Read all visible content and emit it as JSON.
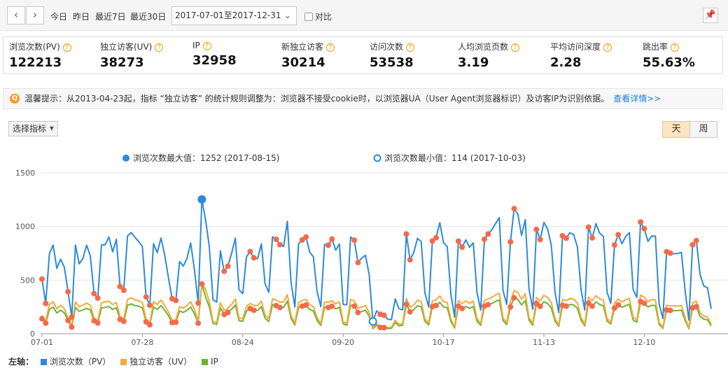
{
  "toolbar": {
    "prev_icon": "chevron-left-icon",
    "next_icon": "chevron-right-icon",
    "quick_ranges": [
      "今日",
      "昨日",
      "最近7日",
      "最近30日"
    ],
    "date_range": "2017-07-01至2017-12-31",
    "compare_label": "对比",
    "pin_icon": "pin-icon"
  },
  "metrics": [
    {
      "label": "浏览次数(PV)",
      "value": "122213"
    },
    {
      "label": "独立访客(UV)",
      "value": "38273"
    },
    {
      "label": "IP",
      "value": "32958"
    },
    {
      "label": "新独立访客",
      "value": "30214"
    },
    {
      "label": "访问次数",
      "value": "53538"
    },
    {
      "label": "人均浏览页数",
      "value": "3.19"
    },
    {
      "label": "平均访问深度",
      "value": "2.28"
    },
    {
      "label": "跳出率",
      "value": "55.63%"
    }
  ],
  "tip": {
    "text": "温馨提示：从2013-04-23起，指标 “独立访客” 的统计规则调整为：浏览器不接受cookie时，以浏览器UA（User Agent浏览器标识）及访客IP为识别依据。",
    "link": "查看详情>>"
  },
  "controls": {
    "metric_selector": "选择指标",
    "day_label": "天",
    "week_label": "周"
  },
  "annotations": {
    "max_label": "浏览次数最大值：1252 (2017-08-15)",
    "min_label": "浏览次数最小值：114 (2017-10-03)"
  },
  "legend": {
    "axis_label": "左轴：",
    "items": [
      {
        "name": "浏览次数（PV）",
        "color": "#2e8ad8"
      },
      {
        "name": "独立访客（UV）",
        "color": "#f5a93a"
      },
      {
        "name": "IP",
        "color": "#6ab52e"
      }
    ]
  },
  "chart_data": {
    "type": "line",
    "ylim": [
      0,
      1500
    ],
    "yticks": [
      "0",
      "500",
      "1000",
      "1500"
    ],
    "xticks": [
      "07-01",
      "07-28",
      "08-24",
      "09-20",
      "10-17",
      "11-13",
      "12-10"
    ],
    "colors": {
      "pv": "#2e8ad8",
      "uv": "#f5a93a",
      "ip": "#6ab52e",
      "weekend_marker": "#f56a4a"
    },
    "series": [
      {
        "name": "浏览次数（PV）",
        "values": [
          509,
          282,
          747,
          826,
          609,
          695,
          620,
          392,
          155,
          826,
          651,
          701,
          826,
          726,
          374,
          332,
          826,
          830,
          902,
          763,
          880,
          440,
          405,
          912,
          943,
          898,
          860,
          812,
          343,
          266,
          839,
          756,
          892,
          733,
          523,
          327,
          310,
          673,
          630,
          702,
          845,
          596,
          286,
          1252,
          1060,
          814,
          317,
          295,
          773,
          582,
          630,
          751,
          891,
          409,
          374,
          719,
          766,
          708,
          700,
          838,
          464,
          386,
          903,
          880,
          830,
          813,
          1048,
          477,
          249,
          839,
          874,
          902,
          762,
          717,
          391,
          252,
          832,
          825,
          883,
          779,
          837,
          272,
          270,
          901,
          872,
          664,
          705,
          731,
          549,
          114,
          213,
          181,
          172,
          136,
          131,
          324,
          233,
          223,
          930,
          689,
          757,
          889,
          859,
          381,
          249,
          864,
          895,
          1035,
          849,
          812,
          363,
          154,
          863,
          807,
          875,
          805,
          848,
          387,
          220,
          880,
          929,
          968,
          1028,
          1082,
          403,
          274,
          856,
          1166,
          1115,
          916,
          1064,
          413,
          229,
          972,
          878,
          1038,
          977,
          824,
          387,
          197,
          913,
          891,
          942,
          924,
          811,
          408,
          220,
          993,
          893,
          1026,
          937,
          906,
          386,
          284,
          827,
          924,
          839,
          905,
          942,
          411,
          338,
          1041,
          979,
          860,
          911,
          909,
          276,
          143,
          765,
          751,
          745,
          749,
          758,
          395,
          127,
          829,
          868,
          552,
          446,
          428,
          232
        ]
      },
      {
        "name": "独立访客（UV）",
        "values": [
          170,
          119,
          272,
          298,
          232,
          265,
          233,
          149,
          75,
          295,
          251,
          266,
          285,
          266,
          145,
          120,
          287,
          296,
          304,
          272,
          290,
          160,
          139,
          319,
          334,
          316,
          308,
          290,
          133,
          101,
          299,
          272,
          314,
          263,
          202,
          125,
          128,
          253,
          239,
          261,
          299,
          224,
          118,
          481,
          410,
          302,
          115,
          105,
          288,
          215,
          238,
          276,
          322,
          145,
          139,
          255,
          281,
          263,
          262,
          303,
          172,
          138,
          325,
          314,
          293,
          296,
          365,
          171,
          98,
          291,
          309,
          320,
          271,
          253,
          149,
          94,
          296,
          293,
          307,
          278,
          297,
          112,
          95,
          320,
          308,
          238,
          248,
          264,
          196,
          58,
          94,
          70,
          69,
          58,
          60,
          125,
          89,
          94,
          329,
          245,
          269,
          312,
          302,
          138,
          99,
          304,
          315,
          352,
          300,
          290,
          137,
          64,
          308,
          282,
          305,
          284,
          304,
          143,
          94,
          308,
          326,
          339,
          362,
          378,
          147,
          103,
          300,
          402,
          384,
          321,
          372,
          150,
          95,
          338,
          306,
          357,
          339,
          288,
          142,
          82,
          318,
          309,
          327,
          323,
          285,
          151,
          89,
          343,
          308,
          355,
          326,
          312,
          140,
          109,
          287,
          323,
          295,
          316,
          328,
          152,
          130,
          360,
          341,
          299,
          318,
          316,
          107,
          60,
          265,
          260,
          258,
          259,
          264,
          148,
          55,
          289,
          302,
          195,
          164,
          155,
          89
        ]
      },
      {
        "name": "IP",
        "values": [
          140,
          99,
          227,
          248,
          194,
          220,
          194,
          124,
          62,
          246,
          209,
          222,
          236,
          222,
          121,
          100,
          240,
          246,
          253,
          227,
          241,
          133,
          116,
          266,
          278,
          263,
          257,
          241,
          111,
          84,
          249,
          226,
          262,
          219,
          168,
          104,
          107,
          211,
          199,
          217,
          249,
          186,
          98,
          464,
          342,
          251,
          96,
          87,
          240,
          179,
          198,
          230,
          268,
          121,
          116,
          212,
          234,
          219,
          218,
          252,
          143,
          115,
          271,
          262,
          244,
          247,
          304,
          142,
          82,
          243,
          257,
          267,
          226,
          211,
          124,
          78,
          247,
          244,
          256,
          232,
          247,
          93,
          79,
          267,
          257,
          198,
          207,
          220,
          163,
          48,
          78,
          58,
          57,
          48,
          50,
          104,
          74,
          78,
          274,
          204,
          224,
          260,
          252,
          115,
          82,
          253,
          263,
          293,
          250,
          242,
          114,
          53,
          257,
          235,
          254,
          237,
          253,
          119,
          78,
          257,
          271,
          282,
          302,
          315,
          122,
          86,
          250,
          335,
          320,
          268,
          310,
          125,
          79,
          282,
          255,
          298,
          282,
          240,
          118,
          68,
          265,
          257,
          272,
          269,
          237,
          126,
          74,
          286,
          257,
          296,
          272,
          260,
          117,
          91,
          239,
          269,
          246,
          263,
          273,
          127,
          108,
          300,
          284,
          249,
          265,
          263,
          89,
          50,
          221,
          217,
          215,
          216,
          220,
          123,
          46,
          241,
          252,
          162,
          137,
          129,
          74
        ]
      }
    ],
    "max": {
      "value": 1252,
      "date": "2017-08-15"
    },
    "min": {
      "value": 114,
      "date": "2017-10-03"
    }
  }
}
